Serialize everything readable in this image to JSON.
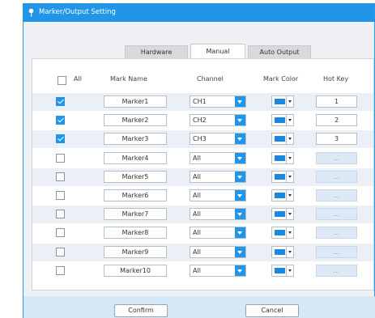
{
  "window": {
    "title": "Marker/Output Setting"
  },
  "tabs": [
    {
      "label": "Hardware"
    },
    {
      "label": "Manual"
    },
    {
      "label": "Auto Output"
    }
  ],
  "active_tab": "Manual",
  "table": {
    "headers": {
      "all": "All",
      "mark_name": "Mark Name",
      "channel": "Channel",
      "mark_color": "Mark Color",
      "hot_key": "Hot Key"
    },
    "rows": [
      {
        "checked": true,
        "name": "Marker1",
        "channel": "CH1",
        "color": "#1b88e0",
        "hotkey": "1"
      },
      {
        "checked": true,
        "name": "Marker2",
        "channel": "CH2",
        "color": "#1b88e0",
        "hotkey": "2"
      },
      {
        "checked": true,
        "name": "Marker3",
        "channel": "CH3",
        "color": "#1b88e0",
        "hotkey": "3"
      },
      {
        "checked": false,
        "name": "Marker4",
        "channel": "All",
        "color": "#1b88e0",
        "hotkey": "..."
      },
      {
        "checked": false,
        "name": "Marker5",
        "channel": "All",
        "color": "#1b88e0",
        "hotkey": "..."
      },
      {
        "checked": false,
        "name": "Marker6",
        "channel": "All",
        "color": "#1b88e0",
        "hotkey": "..."
      },
      {
        "checked": false,
        "name": "Marker7",
        "channel": "All",
        "color": "#1b88e0",
        "hotkey": "..."
      },
      {
        "checked": false,
        "name": "Marker8",
        "channel": "All",
        "color": "#1b88e0",
        "hotkey": "..."
      },
      {
        "checked": false,
        "name": "Marker9",
        "channel": "All",
        "color": "#1b88e0",
        "hotkey": "..."
      },
      {
        "checked": false,
        "name": "Marker10",
        "channel": "All",
        "color": "#1b88e0",
        "hotkey": "..."
      }
    ]
  },
  "buttons": {
    "confirm": "Confirm",
    "cancel": "Cancel"
  },
  "colors": {
    "accent": "#2196e8",
    "row_alt": "#ebf0f6",
    "footer": "#d5e8f8"
  },
  "icons": {
    "app": "pin-icon",
    "dropdown": "chevron-down-icon"
  }
}
